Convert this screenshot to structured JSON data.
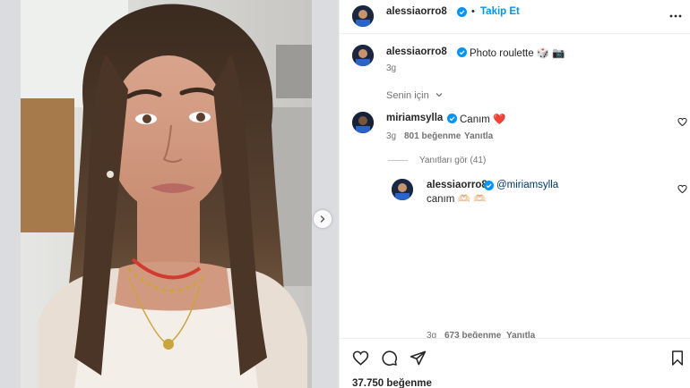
{
  "post": {
    "author": "alessiaorro8",
    "follow_label": "Takip Et",
    "dot": "•",
    "caption": "Photo roulette 🎲 📷",
    "caption_time": "3g",
    "for_you_label": "Senin için",
    "likes_count": "37.750 beğenme"
  },
  "comments": [
    {
      "author": "miriamsylla",
      "text": "Canım ❤️",
      "time": "3g",
      "likes": "801 beğenme",
      "reply_label": "Yanıtla",
      "view_replies": "Yanıtları gör (41)",
      "replies": [
        {
          "author": "alessiaorro8",
          "mention": "@miriamsylla",
          "text": "canım 🫶🏻 🫶🏻"
        }
      ]
    },
    {
      "time": "3g",
      "likes": "673 beğenme",
      "reply_label": "Yanıtla"
    }
  ],
  "colors": {
    "accent": "#0095f6",
    "verified": "#0095f6",
    "like_heart": "#e0245e",
    "muted_text": "#737373"
  },
  "icons": [
    "verified-badge-icon",
    "more-options-icon",
    "chevron-down-icon",
    "heart-icon",
    "comment-icon",
    "share-icon",
    "bookmark-icon",
    "chevron-right-icon"
  ]
}
